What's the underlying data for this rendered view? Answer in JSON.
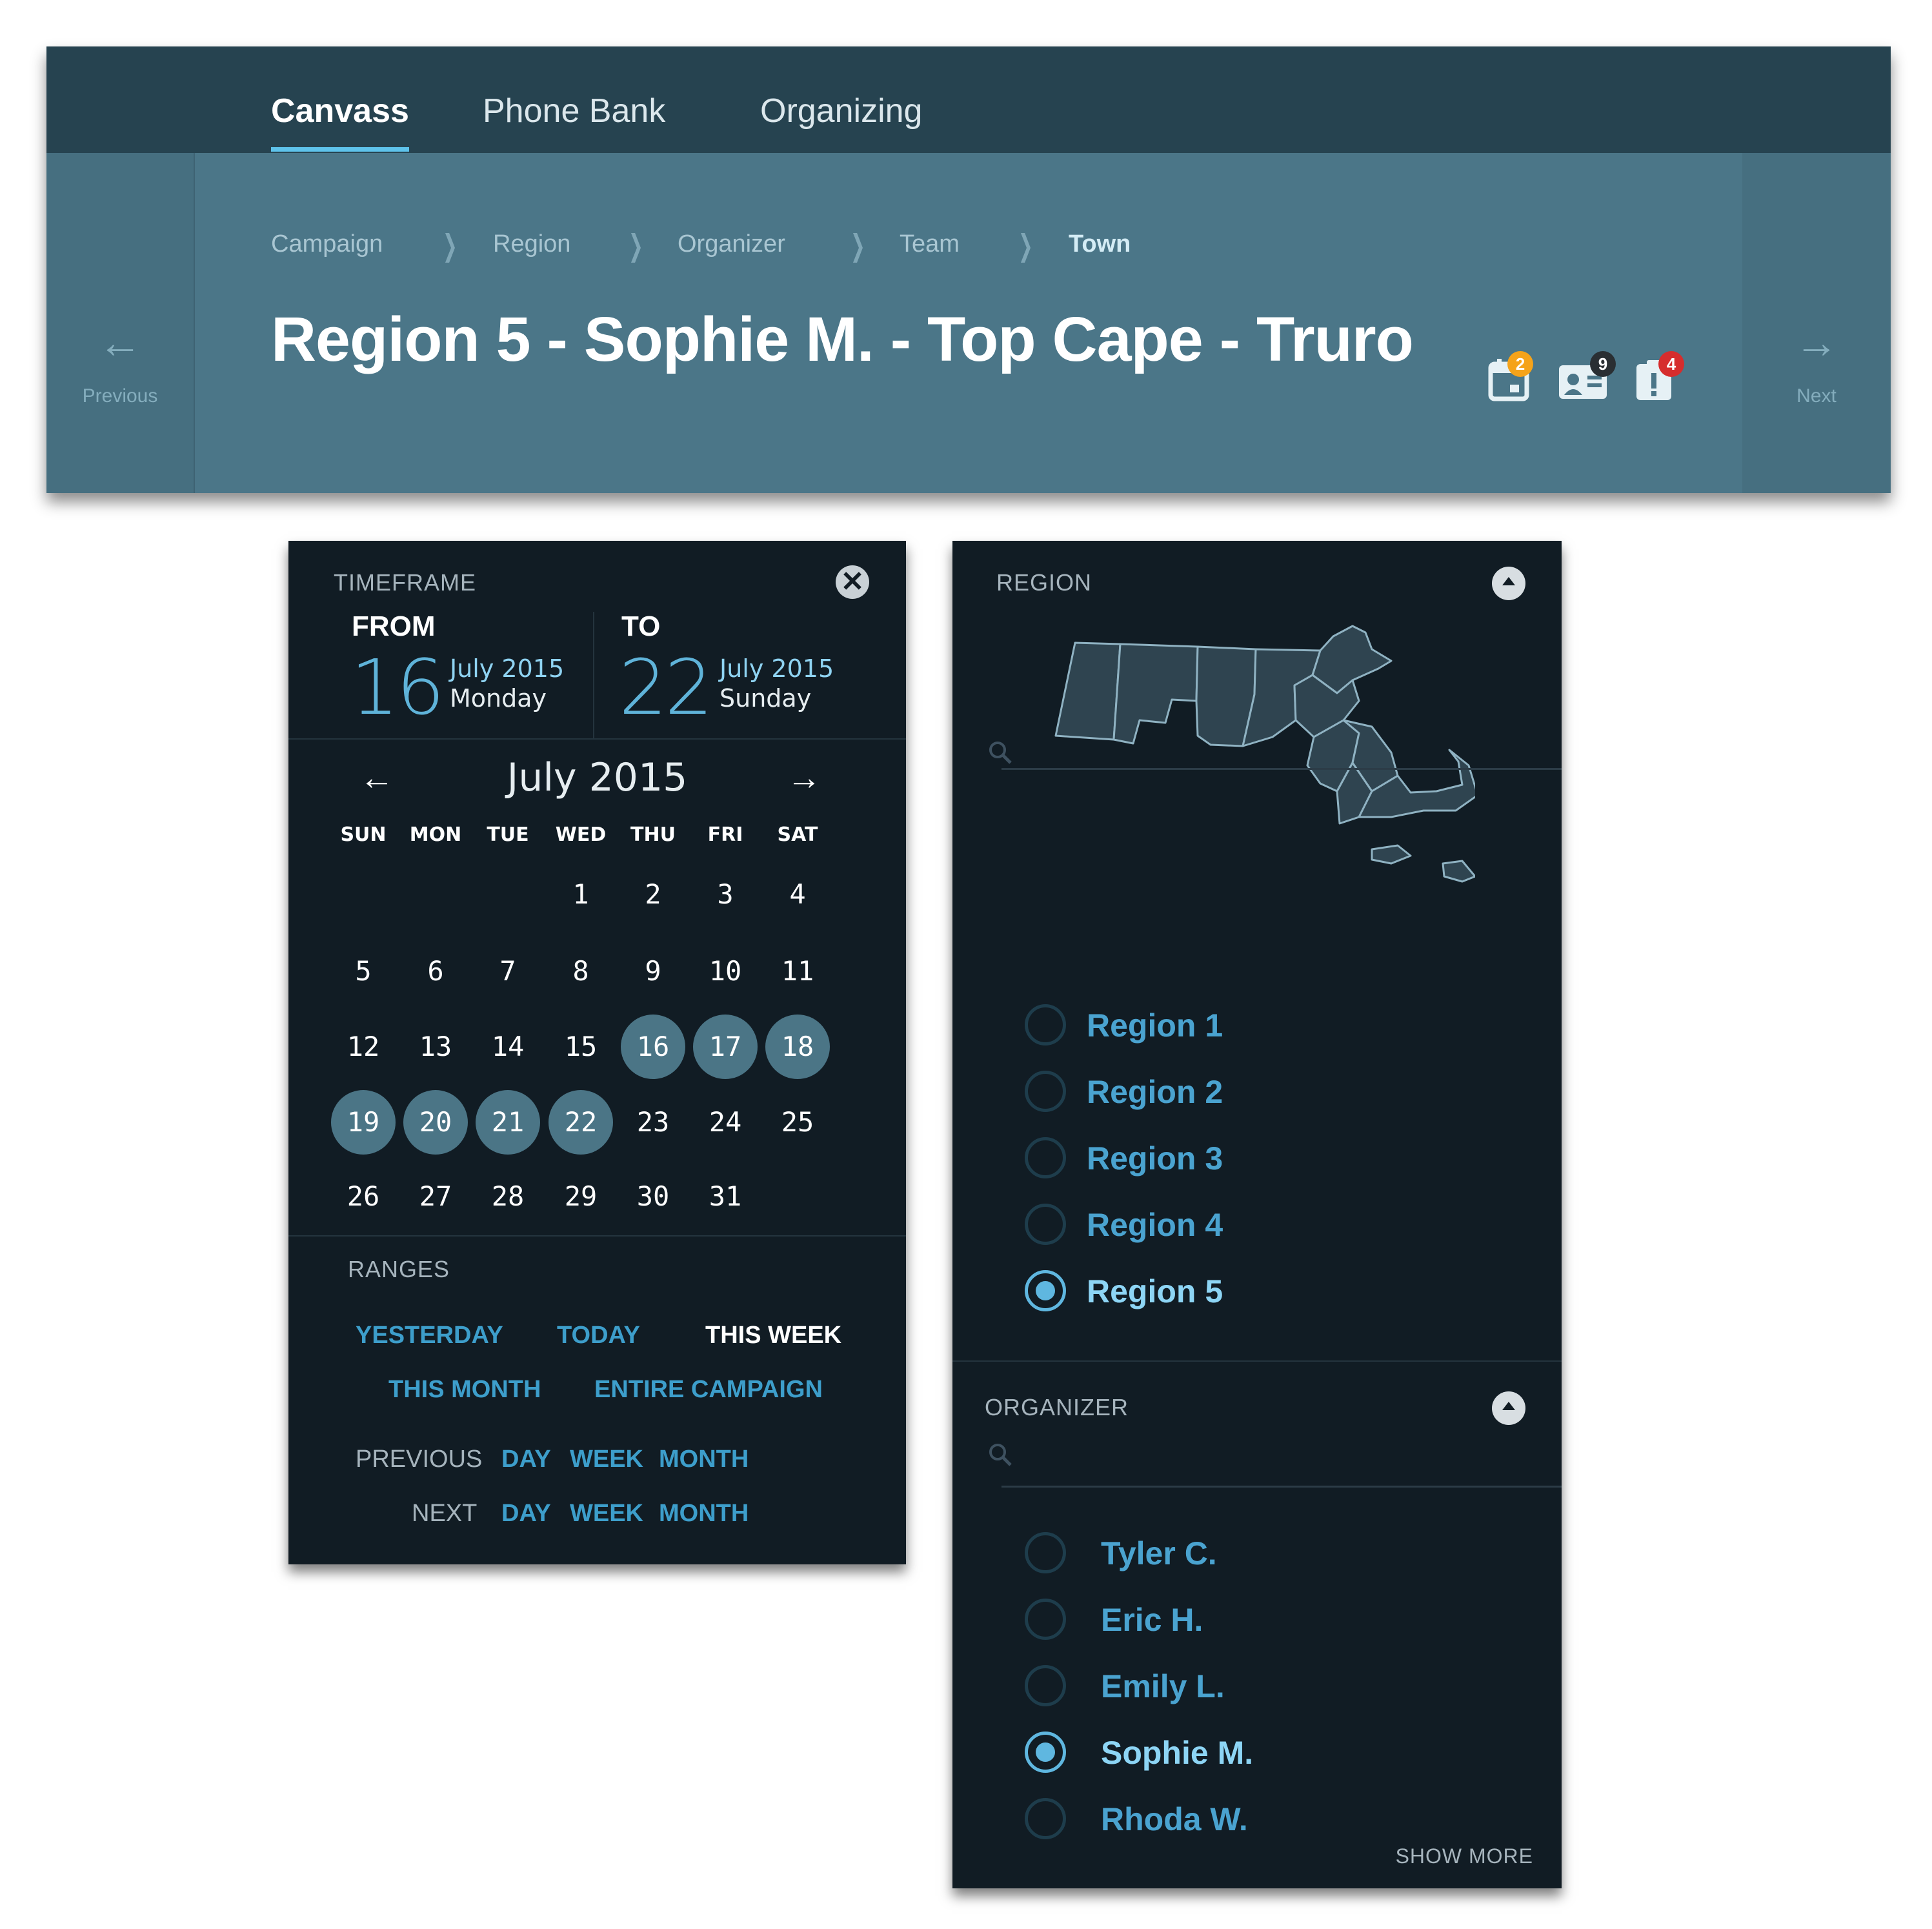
{
  "nav": {
    "tabs": [
      {
        "label": "Canvass",
        "active": true
      },
      {
        "label": "Phone Bank",
        "active": false
      },
      {
        "label": "Organizing",
        "active": false
      }
    ]
  },
  "header": {
    "previous_label": "Previous",
    "next_label": "Next",
    "breadcrumb": [
      "Campaign",
      "Region",
      "Organizer",
      "Team",
      "Town"
    ],
    "title": "Region 5 - Sophie M. - Top Cape - Truro",
    "icons": [
      {
        "name": "calendar-icon",
        "badge": "2",
        "badge_color": "#f5a31a"
      },
      {
        "name": "contact-card-icon",
        "badge": "9",
        "badge_color": "#2a2f33"
      },
      {
        "name": "alert-clipboard-icon",
        "badge": "4",
        "badge_color": "#d62d2d"
      }
    ]
  },
  "timeframe": {
    "label": "TIMEFRAME",
    "from": {
      "heading": "FROM",
      "day": "16",
      "month_year": "July 2015",
      "weekday": "Monday"
    },
    "to": {
      "heading": "TO",
      "day": "22",
      "month_year": "July 2015",
      "weekday": "Sunday"
    },
    "calendar": {
      "month_title": "July 2015",
      "weekdays": [
        "SUN",
        "MON",
        "TUE",
        "WED",
        "THU",
        "FRI",
        "SAT"
      ],
      "first_weekday_index": 3,
      "days_in_month": 31,
      "selected_days": [
        16,
        17,
        18,
        19,
        20,
        21,
        22
      ]
    },
    "ranges": {
      "label": "RANGES",
      "quick": {
        "yesterday": "YESTERDAY",
        "today": "TODAY",
        "this_week": "THIS WEEK",
        "this_month": "THIS MONTH",
        "entire_campaign": "ENTIRE CAMPAIGN"
      },
      "active": "this_week",
      "previous": {
        "label": "PREVIOUS",
        "day": "DAY",
        "week": "WEEK",
        "month": "MONTH"
      },
      "next": {
        "label": "NEXT",
        "day": "DAY",
        "week": "WEEK",
        "month": "MONTH"
      }
    }
  },
  "region": {
    "label": "REGION",
    "search_placeholder": "",
    "options": [
      {
        "label": "Region 1",
        "selected": false
      },
      {
        "label": "Region 2",
        "selected": false
      },
      {
        "label": "Region 3",
        "selected": false
      },
      {
        "label": "Region 4",
        "selected": false
      },
      {
        "label": "Region 5",
        "selected": true
      }
    ]
  },
  "organizer": {
    "label": "ORGANIZER",
    "search_placeholder": "",
    "options": [
      {
        "label": "Tyler C.",
        "selected": false
      },
      {
        "label": "Eric H.",
        "selected": false
      },
      {
        "label": "Emily L.",
        "selected": false
      },
      {
        "label": "Sophie M.",
        "selected": true
      },
      {
        "label": "Rhoda W.",
        "selected": false
      }
    ],
    "show_more": "SHOW MORE"
  },
  "colors": {
    "accent": "#5ec3eb",
    "header_bg": "#4b7688",
    "topnav_bg": "#264350",
    "card_bg": "#111c24",
    "link": "#3d9ecb",
    "selected_day": "#4b7586"
  }
}
